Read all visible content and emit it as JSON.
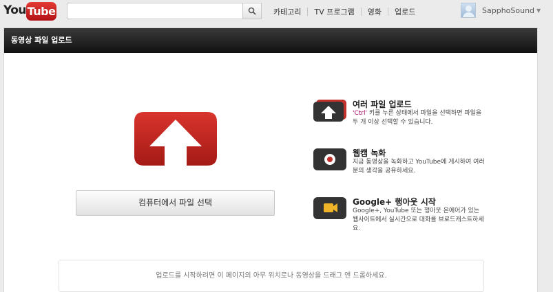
{
  "header": {
    "logo_you": "You",
    "logo_tube": "Tube",
    "search": {
      "placeholder": "",
      "value": ""
    },
    "nav": [
      "카테고리",
      "TV 프로그램",
      "영화",
      "업로드"
    ],
    "user_name": "SapphoSound"
  },
  "panel": {
    "title": "동영상 파일 업로드",
    "select_button": "컴퓨터에서 파일 선택",
    "features": [
      {
        "icon": "multi-upload-icon",
        "title": "여러 파일 업로드",
        "desc_prefix": "'Ctrl'",
        "desc": " 키를 누른 상태에서 파일을 선택하면 파일을 두 개 이상 선택할 수 있습니다."
      },
      {
        "icon": "webcam-record-icon",
        "title": "웹캠 녹화",
        "desc": "지금 동영상을 녹화하고 YouTube에 게시하여 여러분의 생각을 공유하세요."
      },
      {
        "icon": "hangout-icon",
        "title": "Google+ 행아웃 시작",
        "desc": "Google+, YouTube 또는 행아웃 온에어가 있는 웹사이트에서 실시간으로 대화를 브로드캐스트하세요."
      }
    ],
    "drop_hint": "업로드를 시작하려면 이 페이지의 아무 위치로나 동영상을 드래그 앤 드롭하세요."
  },
  "colors": {
    "brand_red": "#c4302b",
    "header_dark": "#1a1a1a"
  }
}
